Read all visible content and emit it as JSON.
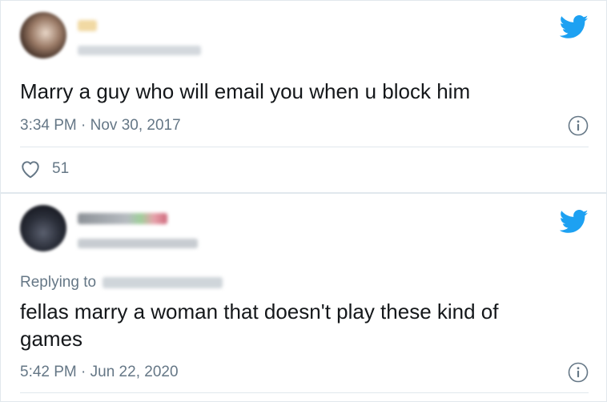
{
  "tweets": [
    {
      "text": "Marry a guy who will email you when u block him",
      "timestamp": "3:34 PM · Nov 30, 2017",
      "likes": "51",
      "icons": [
        "twitter-bird-icon",
        "info-icon",
        "heart-icon"
      ]
    },
    {
      "replying_to": "Replying to",
      "text_line1": "fellas marry a woman that doesn't play these kind of",
      "text_line2": "games",
      "timestamp": "5:42 PM · Jun 22, 2020",
      "icons": [
        "twitter-bird-icon",
        "info-icon"
      ]
    }
  ],
  "colors": {
    "twitter_blue": "#1da1f2",
    "secondary_text": "#657786",
    "border": "#e1e8ed"
  }
}
